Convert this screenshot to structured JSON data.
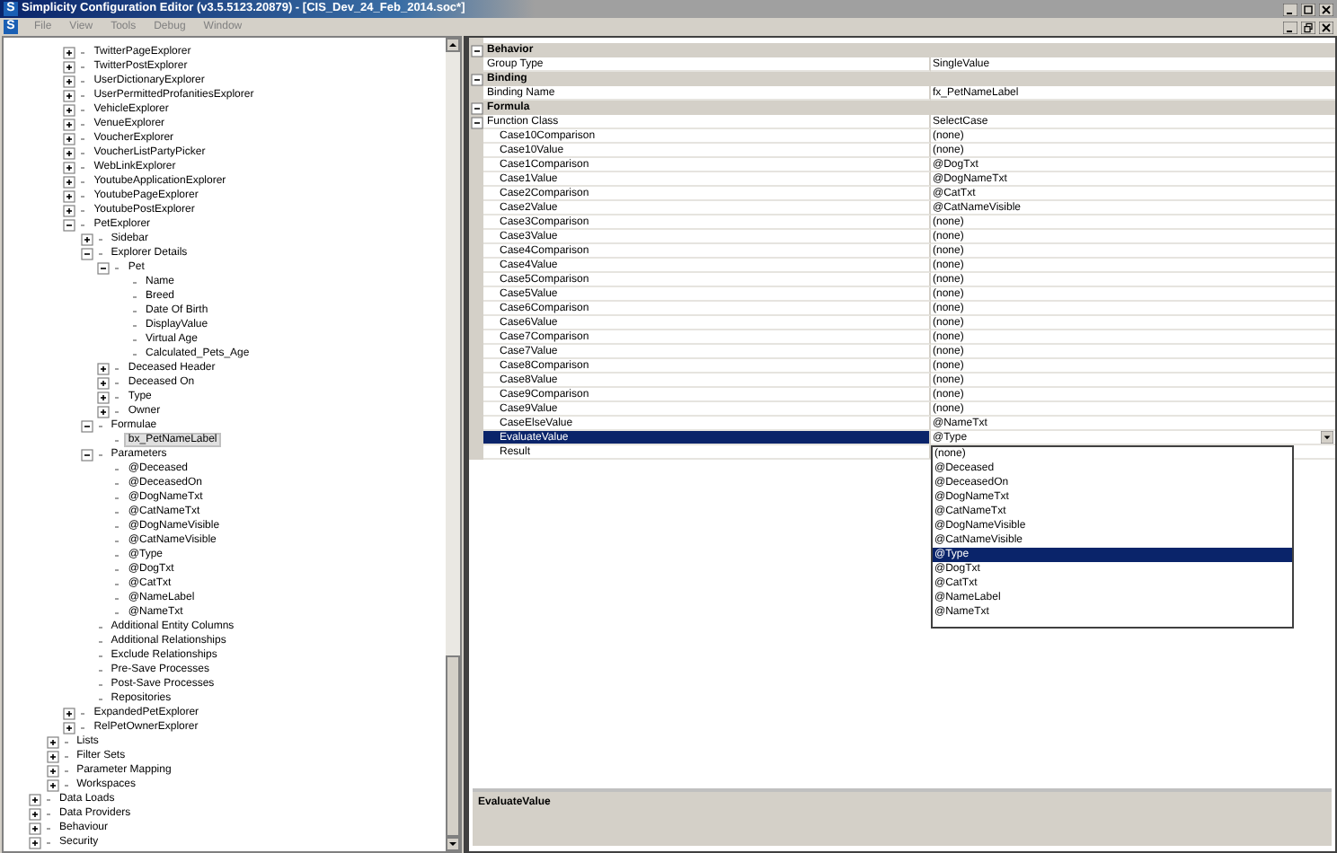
{
  "window": {
    "icon_text": "S",
    "title": "Simplicity Configuration Editor (v3.5.5123.20879) - [CIS_Dev_24_Feb_2014.soc*]"
  },
  "menu": {
    "icon_text": "S",
    "items": [
      "File",
      "View",
      "Tools",
      "Debug",
      "Window"
    ]
  },
  "tree": {
    "items": [
      {
        "children": [
          {
            "children": [
              {
                "label": "TwitterPageExplorer",
                "expanded": false,
                "selected": false
              },
              {
                "label": "TwitterPostExplorer",
                "expanded": false,
                "selected": false
              },
              {
                "label": "UserDictionaryExplorer",
                "expanded": false,
                "selected": false
              },
              {
                "label": "UserPermittedProfanitiesExplorer",
                "expanded": false,
                "selected": false
              },
              {
                "label": "VehicleExplorer",
                "expanded": false,
                "selected": false
              },
              {
                "label": "VenueExplorer",
                "expanded": false,
                "selected": false
              },
              {
                "label": "VoucherExplorer",
                "expanded": false,
                "selected": false
              },
              {
                "label": "VoucherListPartyPicker",
                "expanded": false,
                "selected": false
              },
              {
                "label": "WebLinkExplorer",
                "expanded": false,
                "selected": false
              },
              {
                "label": "YoutubeApplicationExplorer",
                "expanded": false,
                "selected": false
              },
              {
                "label": "YoutubePageExplorer",
                "expanded": false,
                "selected": false
              },
              {
                "label": "YoutubePostExplorer",
                "expanded": false,
                "selected": false
              },
              {
                "label": "PetExplorer",
                "expanded": true,
                "selected": false,
                "children": [
                  {
                    "label": "Sidebar",
                    "expanded": false,
                    "selected": false
                  },
                  {
                    "label": "Explorer Details",
                    "expanded": true,
                    "selected": false,
                    "children": [
                      {
                        "label": "Pet",
                        "expanded": true,
                        "selected": false,
                        "children": [
                          {
                            "label": "Name",
                            "selected": false
                          },
                          {
                            "label": "Breed",
                            "selected": false
                          },
                          {
                            "label": "Date Of Birth",
                            "selected": false
                          },
                          {
                            "label": "DisplayValue",
                            "selected": false
                          },
                          {
                            "label": "Virtual Age",
                            "selected": false
                          },
                          {
                            "label": "Calculated_Pets_Age",
                            "selected": false
                          }
                        ]
                      },
                      {
                        "label": "Deceased Header",
                        "expanded": false,
                        "selected": false
                      },
                      {
                        "label": "Deceased On",
                        "expanded": false,
                        "selected": false
                      },
                      {
                        "label": "Type",
                        "expanded": false,
                        "selected": false
                      },
                      {
                        "label": "Owner",
                        "expanded": false,
                        "selected": false
                      }
                    ]
                  },
                  {
                    "label": "Formulae",
                    "expanded": true,
                    "selected": false,
                    "children": [
                      {
                        "label": "bx_PetNameLabel",
                        "selected": true
                      }
                    ]
                  },
                  {
                    "label": "Parameters",
                    "expanded": true,
                    "selected": false,
                    "children": [
                      {
                        "label": "@Deceased",
                        "selected": false
                      },
                      {
                        "label": "@DeceasedOn",
                        "selected": false
                      },
                      {
                        "label": "@DogNameTxt",
                        "selected": false
                      },
                      {
                        "label": "@CatNameTxt",
                        "selected": false
                      },
                      {
                        "label": "@DogNameVisible",
                        "selected": false
                      },
                      {
                        "label": "@CatNameVisible",
                        "selected": false
                      },
                      {
                        "label": "@Type",
                        "selected": false
                      },
                      {
                        "label": "@DogTxt",
                        "selected": false
                      },
                      {
                        "label": "@CatTxt",
                        "selected": false
                      },
                      {
                        "label": "@NameLabel",
                        "selected": false
                      },
                      {
                        "label": "@NameTxt",
                        "selected": false
                      }
                    ]
                  },
                  {
                    "label": "Additional Entity Columns",
                    "selected": false
                  },
                  {
                    "label": "Additional Relationships",
                    "selected": false
                  },
                  {
                    "label": "Exclude Relationships",
                    "selected": false
                  },
                  {
                    "label": "Pre-Save Processes",
                    "selected": false
                  },
                  {
                    "label": "Post-Save Processes",
                    "selected": false
                  },
                  {
                    "label": "Repositories",
                    "selected": false
                  }
                ]
              },
              {
                "label": "ExpandedPetExplorer",
                "expanded": false,
                "selected": false
              },
              {
                "label": "RelPetOwnerExplorer",
                "expanded": false,
                "selected": false
              }
            ]
          },
          {
            "label": "Lists",
            "expanded": false,
            "selected": false
          },
          {
            "label": "Filter Sets",
            "expanded": false,
            "selected": false
          },
          {
            "label": "Parameter Mapping",
            "expanded": false,
            "selected": false
          },
          {
            "label": "Workspaces",
            "expanded": false,
            "selected": false
          }
        ]
      },
      {
        "label": "Data Loads",
        "expanded": false,
        "selected": false
      },
      {
        "label": "Data Providers",
        "expanded": false,
        "selected": false
      },
      {
        "label": "Behaviour",
        "expanded": false,
        "selected": false
      },
      {
        "label": "Security",
        "expanded": false,
        "selected": false
      }
    ]
  },
  "properties": {
    "rows": [
      {
        "kind": "category",
        "label": "Behavior",
        "expanded": true,
        "children": [
          {
            "kind": "property",
            "name": "Group Type",
            "value": "SingleValue",
            "selected": false
          }
        ]
      },
      {
        "kind": "category",
        "label": "Binding",
        "expanded": true,
        "children": [
          {
            "kind": "property",
            "name": "Binding Name",
            "value": "fx_PetNameLabel",
            "selected": false
          }
        ]
      },
      {
        "kind": "category",
        "label": "Formula",
        "expanded": true,
        "children": [
          {
            "kind": "property",
            "name": "Function Class",
            "value": "SelectCase",
            "selected": false,
            "expanded": true,
            "children": [
              {
                "kind": "property",
                "name": "Case10Comparison",
                "value": "(none)",
                "selected": false
              },
              {
                "kind": "property",
                "name": "Case10Value",
                "value": "(none)",
                "selected": false
              },
              {
                "kind": "property",
                "name": "Case1Comparison",
                "value": "@DogTxt",
                "selected": false
              },
              {
                "kind": "property",
                "name": "Case1Value",
                "value": "@DogNameTxt",
                "selected": false
              },
              {
                "kind": "property",
                "name": "Case2Comparison",
                "value": "@CatTxt",
                "selected": false
              },
              {
                "kind": "property",
                "name": "Case2Value",
                "value": "@CatNameVisible",
                "selected": false
              },
              {
                "kind": "property",
                "name": "Case3Comparison",
                "value": "(none)",
                "selected": false
              },
              {
                "kind": "property",
                "name": "Case3Value",
                "value": "(none)",
                "selected": false
              },
              {
                "kind": "property",
                "name": "Case4Comparison",
                "value": "(none)",
                "selected": false
              },
              {
                "kind": "property",
                "name": "Case4Value",
                "value": "(none)",
                "selected": false
              },
              {
                "kind": "property",
                "name": "Case5Comparison",
                "value": "(none)",
                "selected": false
              },
              {
                "kind": "property",
                "name": "Case5Value",
                "value": "(none)",
                "selected": false
              },
              {
                "kind": "property",
                "name": "Case6Comparison",
                "value": "(none)",
                "selected": false
              },
              {
                "kind": "property",
                "name": "Case6Value",
                "value": "(none)",
                "selected": false
              },
              {
                "kind": "property",
                "name": "Case7Comparison",
                "value": "(none)",
                "selected": false
              },
              {
                "kind": "property",
                "name": "Case7Value",
                "value": "(none)",
                "selected": false
              },
              {
                "kind": "property",
                "name": "Case8Comparison",
                "value": "(none)",
                "selected": false
              },
              {
                "kind": "property",
                "name": "Case8Value",
                "value": "(none)",
                "selected": false
              },
              {
                "kind": "property",
                "name": "Case9Comparison",
                "value": "(none)",
                "selected": false
              },
              {
                "kind": "property",
                "name": "Case9Value",
                "value": "(none)",
                "selected": false
              },
              {
                "kind": "property",
                "name": "CaseElseValue",
                "value": "@NameTxt",
                "selected": false
              },
              {
                "kind": "property",
                "name": "EvaluateValue",
                "value": "@Type",
                "selected": true,
                "dropdown": {
                  "options": [
                    {
                      "label": "(none)",
                      "selected": false
                    },
                    {
                      "label": "@Deceased",
                      "selected": false
                    },
                    {
                      "label": "@DeceasedOn",
                      "selected": false
                    },
                    {
                      "label": "@DogNameTxt",
                      "selected": false
                    },
                    {
                      "label": "@CatNameTxt",
                      "selected": false
                    },
                    {
                      "label": "@DogNameVisible",
                      "selected": false
                    },
                    {
                      "label": "@CatNameVisible",
                      "selected": false
                    },
                    {
                      "label": "@Type",
                      "selected": true
                    },
                    {
                      "label": "@DogTxt",
                      "selected": false
                    },
                    {
                      "label": "@CatTxt",
                      "selected": false
                    },
                    {
                      "label": "@NameLabel",
                      "selected": false
                    },
                    {
                      "label": "@NameTxt",
                      "selected": false
                    }
                  ]
                }
              },
              {
                "kind": "property",
                "name": "Result",
                "selected": false
              }
            ]
          }
        ]
      }
    ]
  },
  "description": {
    "title": "EvaluateValue"
  }
}
